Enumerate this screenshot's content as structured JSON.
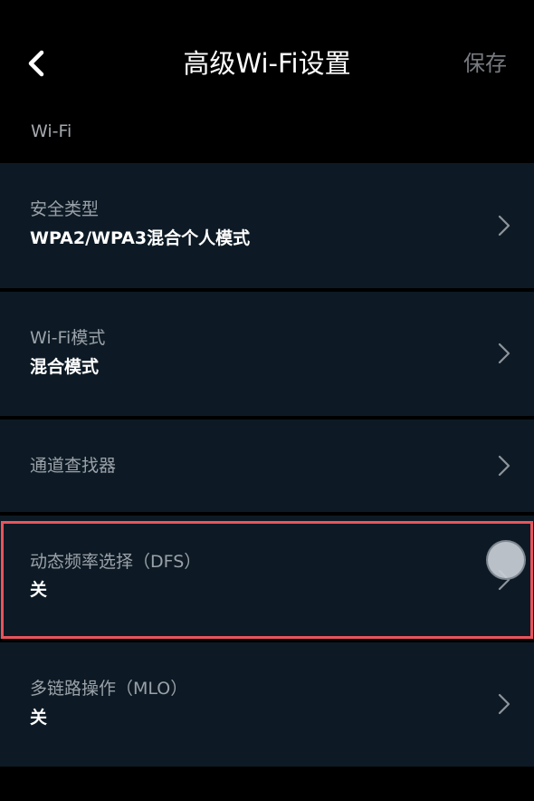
{
  "header": {
    "back_icon": "chevron-left-icon",
    "title": "高级Wi-Fi设置",
    "save_label": "保存"
  },
  "section": {
    "label": "Wi-Fi"
  },
  "items": [
    {
      "label": "安全类型",
      "value": "WPA2/WPA3混合个人模式"
    },
    {
      "label": "Wi-Fi模式",
      "value": "混合模式"
    },
    {
      "label": "通道查找器",
      "value": ""
    },
    {
      "label": "动态频率选择（DFS）",
      "value": "关"
    },
    {
      "label": "多链路操作（MLO）",
      "value": "关"
    }
  ],
  "icons": {
    "item_chevron": "chevron-right-icon"
  },
  "colors": {
    "background": "#000000",
    "item_background": "#0d1a25",
    "label_text": "#9aa1a8",
    "value_text": "#ffffff",
    "save_text": "#777b80",
    "highlight_border": "#e8545c"
  }
}
